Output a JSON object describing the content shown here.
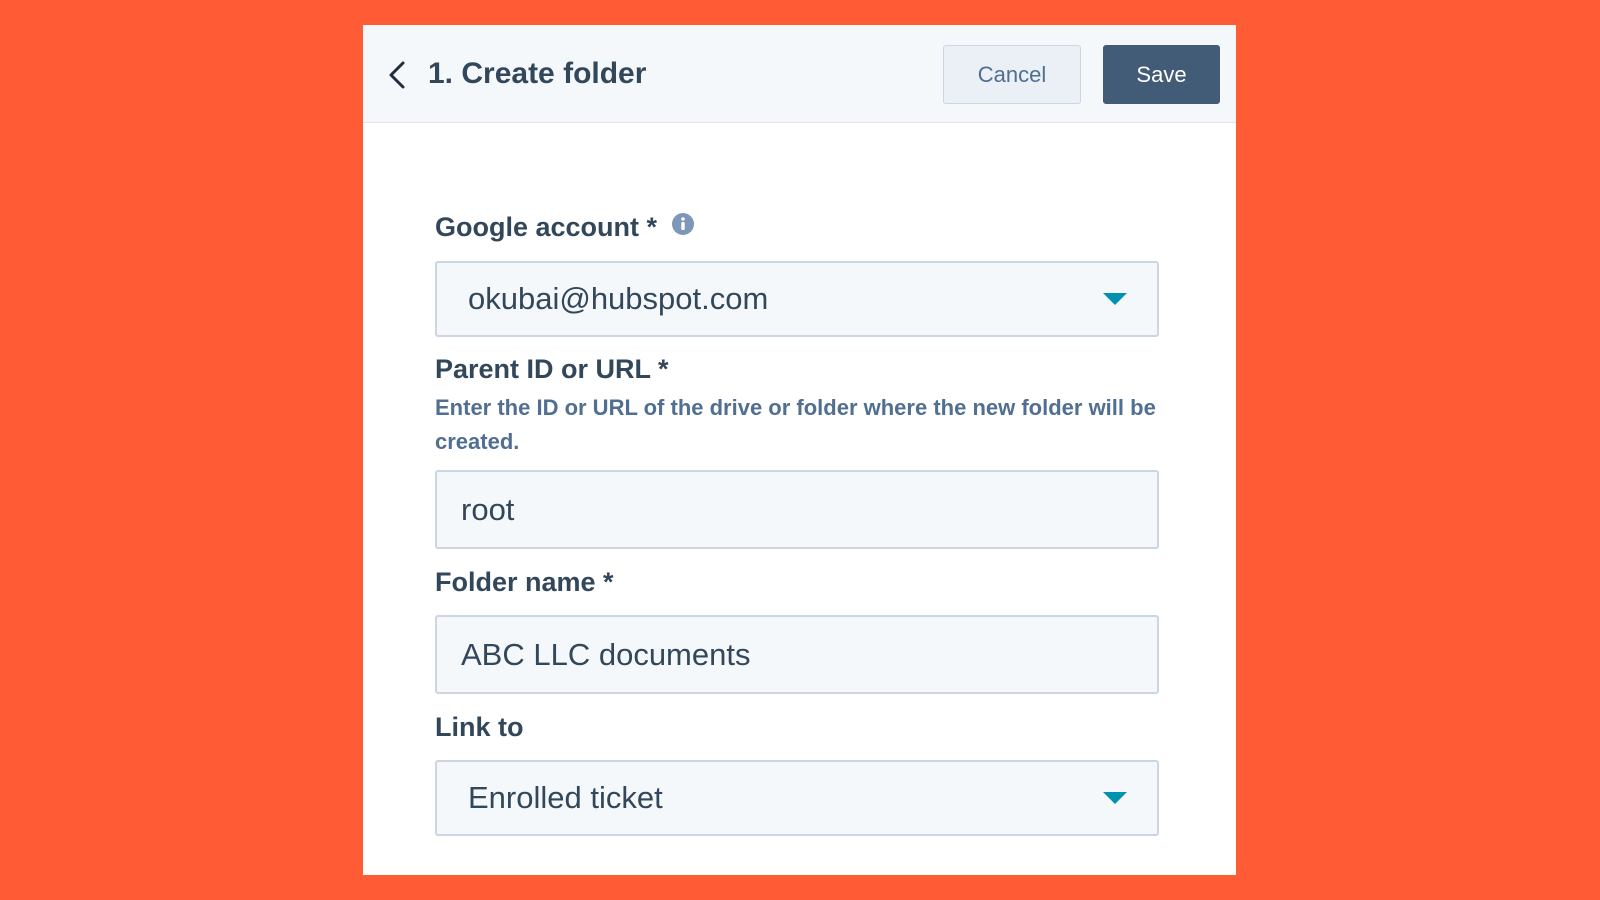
{
  "header": {
    "title": "1. Create folder",
    "cancel_label": "Cancel",
    "save_label": "Save"
  },
  "fields": {
    "google_account": {
      "label": "Google account *",
      "value": "okubai@hubspot.com"
    },
    "parent_id": {
      "label": "Parent ID or URL *",
      "help": "Enter the ID or URL of the drive or folder where the new folder will be created.",
      "value": "root"
    },
    "folder_name": {
      "label": "Folder name *",
      "value": "ABC LLC documents"
    },
    "link_to": {
      "label": "Link to",
      "value": "Enrolled ticket"
    }
  },
  "icons": {
    "back": "chevron-left-icon",
    "info": "info-icon",
    "dropdown": "caret-down-icon"
  },
  "colors": {
    "background": "#ff5c35",
    "panel": "#ffffff",
    "header_bg": "#f5f8fa",
    "save_button": "#425b76",
    "caret": "#0091ae",
    "text": "#33475b",
    "help_text": "#516f90"
  }
}
